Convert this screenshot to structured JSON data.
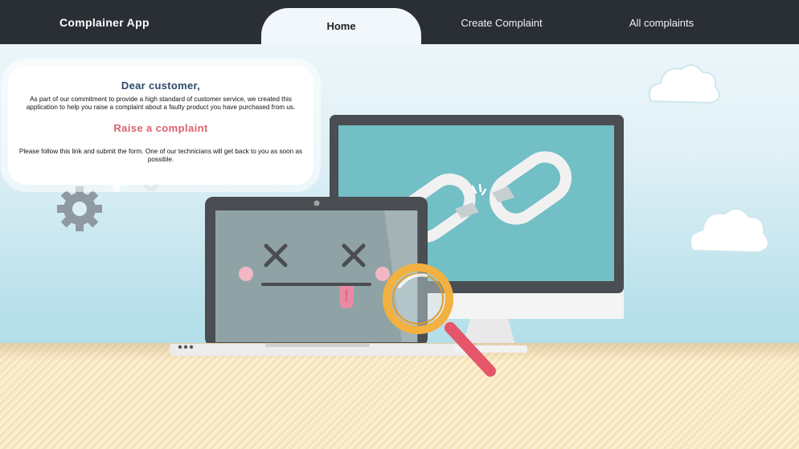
{
  "navbar": {
    "brand": "Complainer App",
    "tabs": [
      {
        "label": "Home",
        "active": true
      },
      {
        "label": "Create Complaint",
        "active": false
      },
      {
        "label": "All complaints",
        "active": false
      }
    ]
  },
  "card": {
    "heading": "Dear customer,",
    "intro": "As part of our commitment to provide a high standard of customer service, we created this application to help you raise a complaint about a faulty product you have purchased from us.",
    "cta": "Raise a complaint",
    "follow": "Please follow this link and submit the form. One of our technicians will get back to you as soon as possible."
  },
  "colors": {
    "navbar": "#2a2e35",
    "cta": "#d9626c",
    "heading": "#2d4a6b",
    "monitor_screen": "#72bfc6",
    "laptop_screen": "#8fa3a6",
    "magnifier": "#f3b13f",
    "magnifier_handle": "#e5566a"
  },
  "icons": [
    "gear-icon",
    "broken-chain-icon",
    "dead-face-icon",
    "magnifier-icon",
    "cloud-icon"
  ]
}
